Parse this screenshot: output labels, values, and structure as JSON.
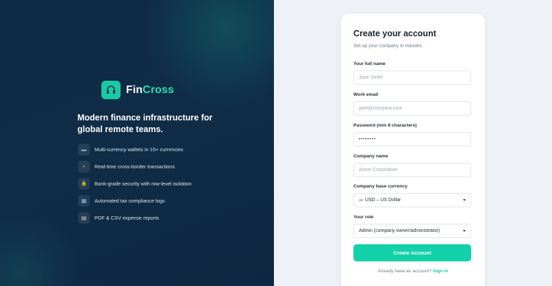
{
  "brand": {
    "name_part1": "Fin",
    "name_part2": "Cross",
    "accent_color": "#19c9a4",
    "logo_icon": "headset-icon"
  },
  "tagline": "Modern finance infrastructure for global remote teams.",
  "features": [
    {
      "icon": "credit-card-icon",
      "glyph": "▬",
      "text": "Multi-currency wallets in 15+ currencies"
    },
    {
      "icon": "lightning-icon",
      "glyph": "⚡",
      "text": "Real-time cross-border transactions"
    },
    {
      "icon": "lock-icon",
      "glyph": "🔒",
      "text": "Bank-grade security with row-level isolation"
    },
    {
      "icon": "chart-icon",
      "glyph": "▦",
      "text": "Automated tax compliance logs"
    },
    {
      "icon": "clipboard-icon",
      "glyph": "▤",
      "text": "PDF & CSV expense reports"
    }
  ],
  "form": {
    "title": "Create your account",
    "subtitle": "Set up your company in minutes",
    "full_name": {
      "label": "Your full name",
      "placeholder": "Jane Smith",
      "value": ""
    },
    "email": {
      "label": "Work email",
      "placeholder": "jane@company.com",
      "value": ""
    },
    "password": {
      "label": "Password (min 8 characters)",
      "value": "••••••••"
    },
    "company": {
      "label": "Company name",
      "placeholder": "Acme Corporation",
      "value": ""
    },
    "currency": {
      "label": "Company base currency",
      "flag": "us",
      "selected": "USD – US Dollar"
    },
    "role": {
      "label": "Your role",
      "selected": "Admin (company owner/administrator)"
    },
    "submit_label": "Create Account",
    "signin_prompt": "Already have an account?",
    "signin_link": "Sign in"
  }
}
